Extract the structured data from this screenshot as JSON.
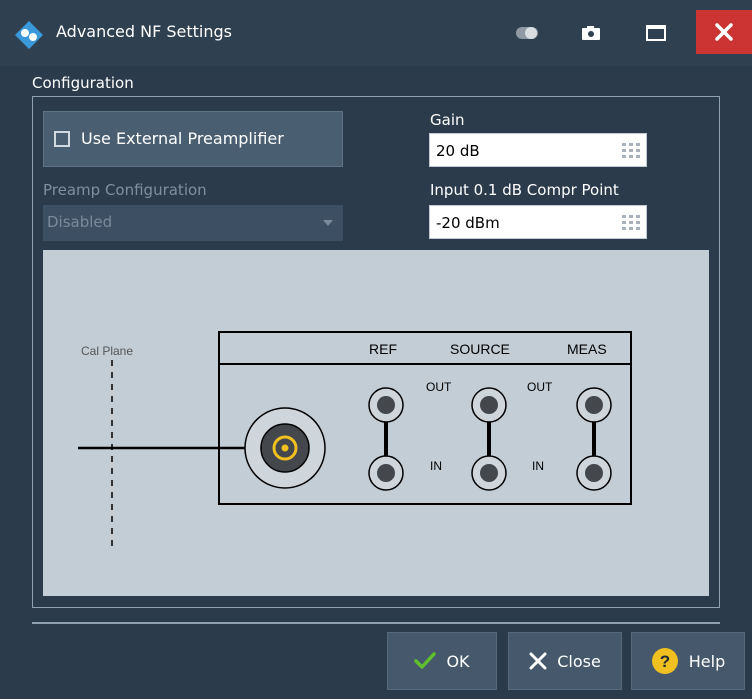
{
  "window": {
    "title": "Advanced NF Settings"
  },
  "titlebar_icons": [
    "logo-icon",
    "toggle-icon",
    "camera-icon",
    "maximize-icon",
    "close-icon"
  ],
  "config": {
    "group_label": "Configuration",
    "use_external_preamp": {
      "label": "Use External Preamplifier",
      "checked": false
    },
    "preamp_config": {
      "label": "Preamp Configuration",
      "value": "Disabled"
    },
    "gain": {
      "label": "Gain",
      "value": "20 dB"
    },
    "compr_point": {
      "label": "Input 0.1 dB Compr Point",
      "value": "-20 dBm"
    }
  },
  "diagram": {
    "cal_plane": "Cal Plane",
    "ports": {
      "ref": "REF",
      "source": "SOURCE",
      "meas": "MEAS"
    },
    "out": "OUT",
    "in": "IN"
  },
  "buttons": {
    "ok": "OK",
    "close": "Close",
    "help": "Help"
  },
  "colors": {
    "accent_close": "#cc3333",
    "ok_check": "#5fbf2f",
    "help_badge": "#f0c020",
    "connector_center": "#f0c020"
  }
}
